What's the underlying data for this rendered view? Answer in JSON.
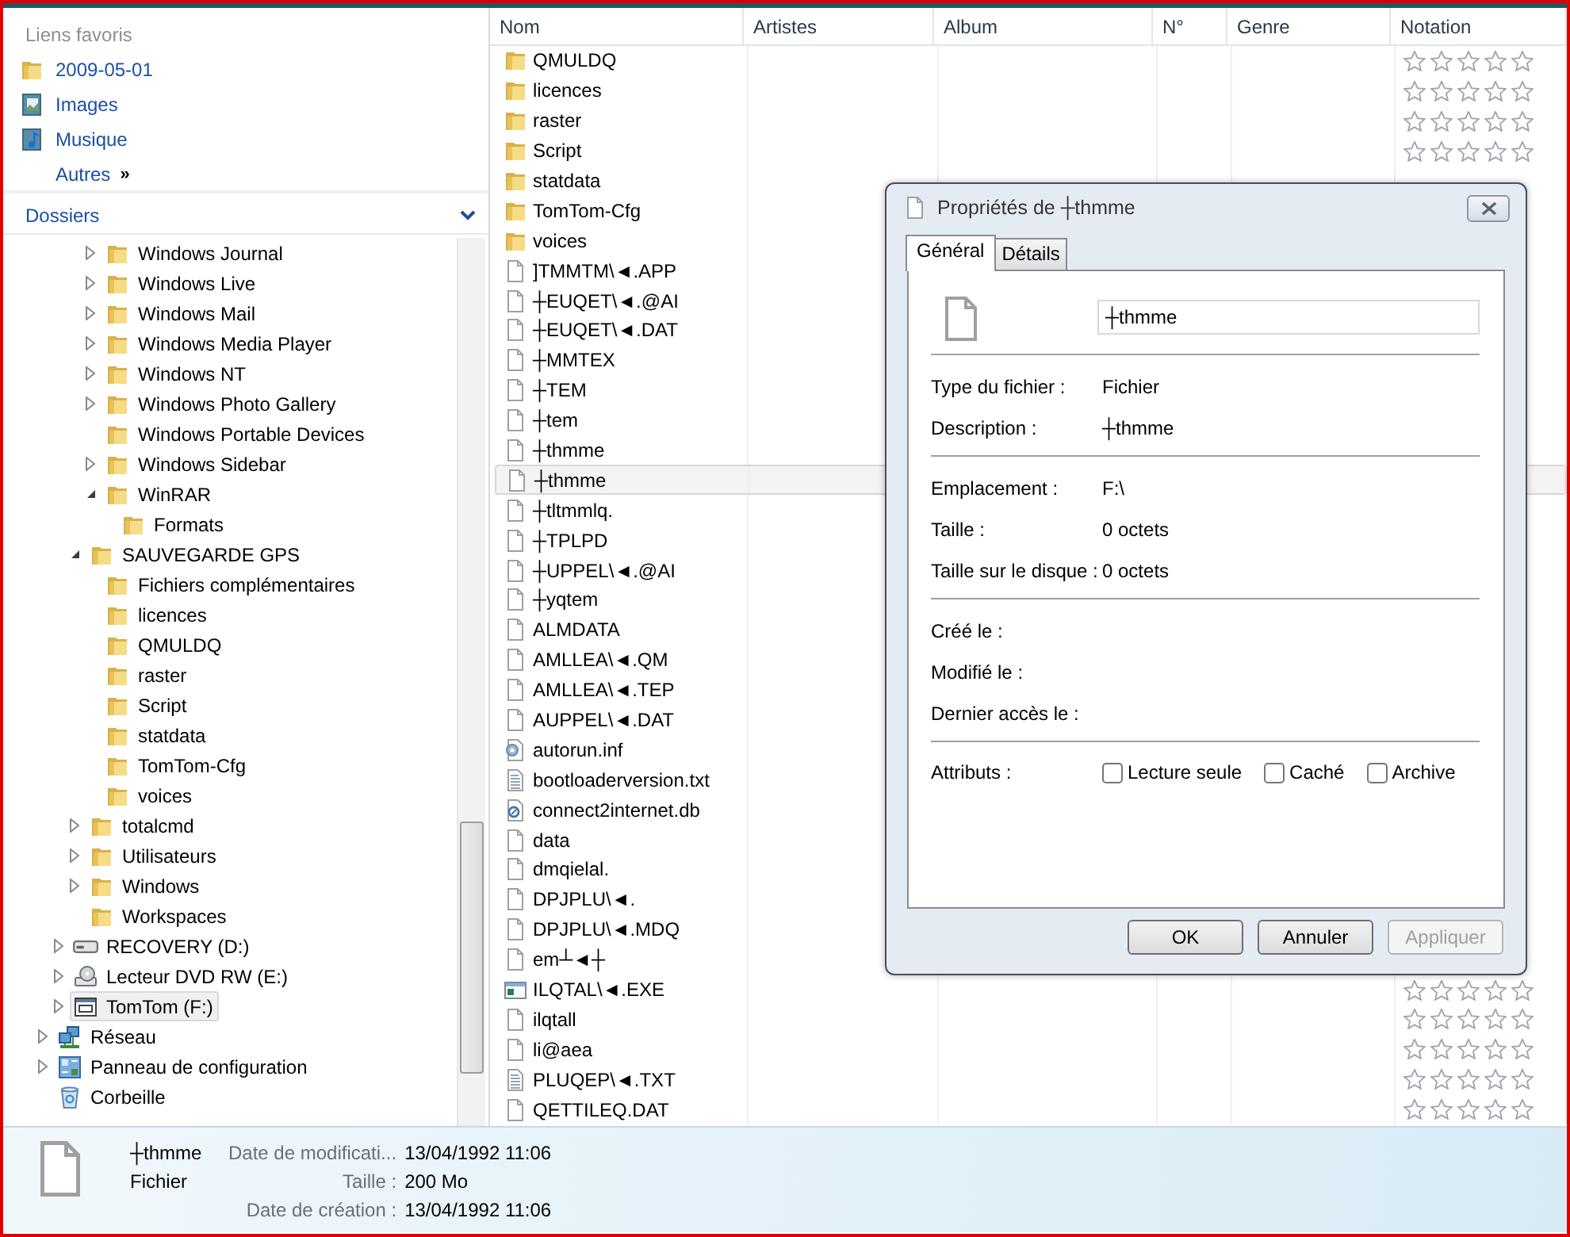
{
  "favorites": {
    "heading": "Liens favoris",
    "items": [
      {
        "label": "2009-05-01",
        "kind": "folder"
      },
      {
        "label": "Images",
        "kind": "pictures"
      },
      {
        "label": "Musique",
        "kind": "music"
      },
      {
        "label": "Autres",
        "more": "»"
      }
    ]
  },
  "folders_header": {
    "label": "Dossiers"
  },
  "tree": [
    {
      "children": [
        {
          "children": [
            {
              "children": [
                {
                  "label": "Windows Journal",
                  "kind": "folder",
                  "expanded": false,
                  "selected": false
                },
                {
                  "label": "Windows Live",
                  "kind": "folder",
                  "expanded": false,
                  "selected": false
                },
                {
                  "label": "Windows Mail",
                  "kind": "folder",
                  "expanded": false,
                  "selected": false
                },
                {
                  "label": "Windows Media Player",
                  "kind": "folder",
                  "expanded": false,
                  "selected": false
                },
                {
                  "label": "Windows NT",
                  "kind": "folder",
                  "expanded": false,
                  "selected": false
                },
                {
                  "label": "Windows Photo Gallery",
                  "kind": "folder",
                  "expanded": false,
                  "selected": false
                },
                {
                  "label": "Windows Portable Devices",
                  "kind": "folder",
                  "selected": false
                },
                {
                  "label": "Windows Sidebar",
                  "kind": "folder",
                  "expanded": false,
                  "selected": false
                },
                {
                  "label": "WinRAR",
                  "kind": "folder",
                  "expanded": true,
                  "selected": false,
                  "children": [
                    {
                      "label": "Formats",
                      "kind": "folder",
                      "selected": false
                    }
                  ]
                }
              ]
            },
            {
              "label": "SAUVEGARDE GPS",
              "kind": "folder",
              "expanded": true,
              "selected": false,
              "children": [
                {
                  "label": "Fichiers complémentaires",
                  "kind": "folder",
                  "selected": false
                },
                {
                  "label": "licences",
                  "kind": "folder",
                  "selected": false
                },
                {
                  "label": "QMULDQ",
                  "kind": "folder",
                  "selected": false
                },
                {
                  "label": "raster",
                  "kind": "folder",
                  "selected": false
                },
                {
                  "label": "Script",
                  "kind": "folder",
                  "selected": false
                },
                {
                  "label": "statdata",
                  "kind": "folder",
                  "selected": false
                },
                {
                  "label": "TomTom-Cfg",
                  "kind": "folder",
                  "selected": false
                },
                {
                  "label": "voices",
                  "kind": "folder",
                  "selected": false
                }
              ]
            },
            {
              "label": "totalcmd",
              "kind": "folder",
              "expanded": false,
              "selected": false
            },
            {
              "label": "Utilisateurs",
              "kind": "folder",
              "expanded": false,
              "selected": false
            },
            {
              "label": "Windows",
              "kind": "folder",
              "expanded": false,
              "selected": false
            },
            {
              "label": "Workspaces",
              "kind": "folder",
              "selected": false
            }
          ]
        },
        {
          "label": "RECOVERY (D:)",
          "kind": "drive",
          "expanded": false,
          "selected": false
        },
        {
          "label": "Lecteur DVD RW (E:)",
          "kind": "dvd",
          "expanded": false,
          "selected": false
        },
        {
          "label": "TomTom (F:)",
          "kind": "device",
          "expanded": false,
          "selected": true
        }
      ]
    },
    {
      "label": "Réseau",
      "kind": "network",
      "expanded": false,
      "selected": false
    },
    {
      "label": "Panneau de configuration",
      "kind": "control",
      "expanded": false,
      "selected": false
    },
    {
      "label": "Corbeille",
      "kind": "recycle",
      "selected": false
    }
  ],
  "columns": [
    "Nom",
    "Artistes",
    "Album",
    "N°",
    "Genre",
    "Notation"
  ],
  "rows": [
    {
      "name": "QMULDQ",
      "kind": "folder",
      "selected": false,
      "stars": 0
    },
    {
      "name": "licences",
      "kind": "folder",
      "selected": false,
      "stars": 0
    },
    {
      "name": "raster",
      "kind": "folder",
      "selected": false,
      "stars": 0
    },
    {
      "name": "Script",
      "kind": "folder",
      "selected": false,
      "stars": 0
    },
    {
      "name": "statdata",
      "kind": "folder",
      "selected": false
    },
    {
      "name": "TomTom-Cfg",
      "kind": "folder",
      "selected": false
    },
    {
      "name": "voices",
      "kind": "folder",
      "selected": false
    },
    {
      "name": "]TMMTM\\◄.APP",
      "kind": "file",
      "selected": false
    },
    {
      "name": "┼EUQET\\◄.@AI",
      "kind": "file",
      "selected": false
    },
    {
      "name": "┼EUQET\\◄.DAT",
      "kind": "file",
      "selected": false
    },
    {
      "name": "┼MMTEX",
      "kind": "file",
      "selected": false
    },
    {
      "name": "┼TEM",
      "kind": "file",
      "selected": false
    },
    {
      "name": "┼tem",
      "kind": "file",
      "selected": false
    },
    {
      "name": "┼thmme",
      "kind": "file",
      "selected": false
    },
    {
      "name": "┼thmme",
      "kind": "file",
      "selected": true
    },
    {
      "name": "┼tltmmlq.",
      "kind": "file",
      "selected": false
    },
    {
      "name": "┼TPLPD",
      "kind": "file",
      "selected": false
    },
    {
      "name": "┼UPPEL\\◄.@AI",
      "kind": "file",
      "selected": false
    },
    {
      "name": "┼yqtem",
      "kind": "file",
      "selected": false
    },
    {
      "name": "ALMDATA",
      "kind": "file",
      "selected": false
    },
    {
      "name": "AMLLEA\\◄.QM",
      "kind": "file",
      "selected": false
    },
    {
      "name": "AMLLEA\\◄.TEP",
      "kind": "file",
      "selected": false
    },
    {
      "name": "AUPPEL\\◄.DAT",
      "kind": "file",
      "selected": false
    },
    {
      "name": "autorun.inf",
      "kind": "settings",
      "selected": false
    },
    {
      "name": "bootloaderversion.txt",
      "kind": "text",
      "selected": false
    },
    {
      "name": "connect2internet.db",
      "kind": "link",
      "selected": false
    },
    {
      "name": "data",
      "kind": "file",
      "selected": false
    },
    {
      "name": "dmqielal.",
      "kind": "file",
      "selected": false
    },
    {
      "name": "DPJPLU\\◄.",
      "kind": "file",
      "selected": false
    },
    {
      "name": "DPJPLU\\◄.MDQ",
      "kind": "file",
      "selected": false
    },
    {
      "name": "em┴◄┼",
      "kind": "file",
      "selected": false
    },
    {
      "name": "ILQTAL\\◄.EXE",
      "kind": "program",
      "selected": false,
      "stars": 0
    },
    {
      "name": "ilqtall",
      "kind": "file",
      "selected": false,
      "stars": 0
    },
    {
      "name": "li@aea",
      "kind": "file",
      "selected": false,
      "stars": 0
    },
    {
      "name": "PLUQEP\\◄.TXT",
      "kind": "text",
      "selected": false,
      "stars": 0
    },
    {
      "name": "QETTILEQ.DAT",
      "kind": "file",
      "selected": false,
      "stars": 0
    }
  ],
  "dialog": {
    "title": "Propriétés de ┼thmme",
    "tabs": [
      {
        "label": "Général",
        "selected": true
      },
      {
        "label": "Détails",
        "selected": false
      }
    ],
    "name_value": "┼thmme",
    "sections": [
      [
        {
          "label": "Type du fichier :",
          "value": "Fichier"
        },
        {
          "label": "Description :",
          "value": "┼thmme"
        }
      ],
      [
        {
          "label": "Emplacement :",
          "value": "F:\\"
        },
        {
          "label": "Taille :",
          "value": "0 octets"
        },
        {
          "label": "Taille sur le disque :",
          "value": "0 octets"
        }
      ],
      [
        {
          "label": "Créé le :"
        },
        {
          "label": "Modifié le :"
        },
        {
          "label": "Dernier accès le :"
        }
      ]
    ],
    "attributes_label": "Attributs :",
    "attributes": [
      {
        "label": "Lecture seule",
        "checked": false
      },
      {
        "label": "Caché",
        "checked": false
      },
      {
        "label": "Archive",
        "checked": false
      }
    ],
    "buttons": [
      {
        "label": "OK",
        "disabled": false
      },
      {
        "label": "Annuler",
        "disabled": false
      },
      {
        "label": "Appliquer",
        "disabled": true
      }
    ]
  },
  "status_bar": {
    "name": "┼thmme",
    "type": "Fichier",
    "details": [
      {
        "label": "Date de modificati...",
        "value": "13/04/1992 11:06"
      },
      {
        "label": "Taille :",
        "value": "200 Mo"
      },
      {
        "label": "Date de création :",
        "value": "13/04/1992 11:06"
      }
    ]
  }
}
